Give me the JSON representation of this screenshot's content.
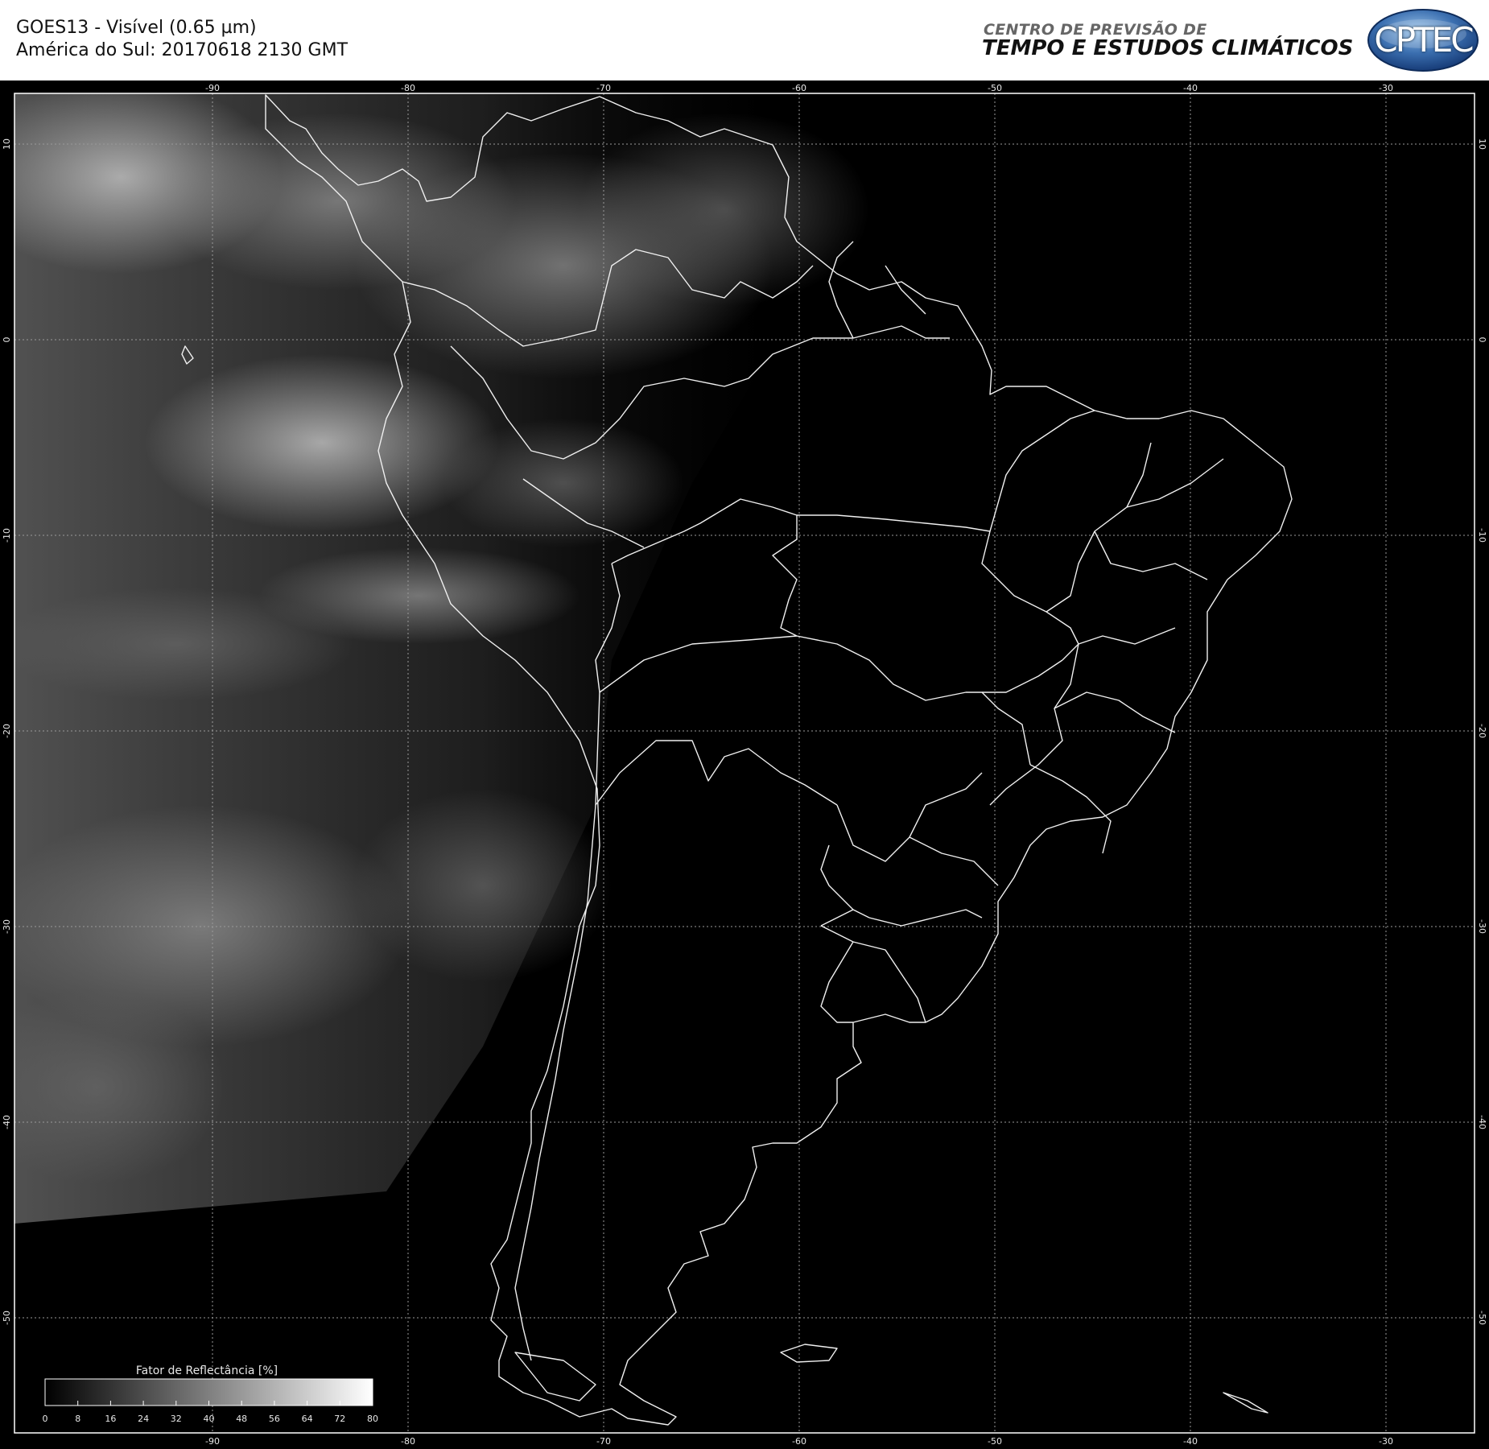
{
  "header": {
    "title_line1": "GOES13 - Visível (0.65 µm)",
    "title_line2": "América do Sul: 20170618 2130 GMT",
    "org_line1": "CENTRO DE PREVISÃO DE",
    "org_line2": "TEMPO E ESTUDOS CLIMÁTICOS",
    "logo_text": "CPTEC"
  },
  "map": {
    "lon_labels": [
      "-90",
      "-80",
      "-70",
      "-60",
      "-50",
      "-40",
      "-30"
    ],
    "lat_labels": [
      "10",
      "0",
      "-10",
      "-20",
      "-30",
      "-40",
      "-50"
    ],
    "grid": true,
    "background": "#000000",
    "border_color": "#ffffff"
  },
  "colorbar": {
    "title": "Fator de Reflectância [%]",
    "ticks": [
      "0",
      "8",
      "16",
      "24",
      "32",
      "40",
      "48",
      "56",
      "64",
      "72",
      "80"
    ],
    "min_color": "#000000",
    "max_color": "#ffffff"
  }
}
